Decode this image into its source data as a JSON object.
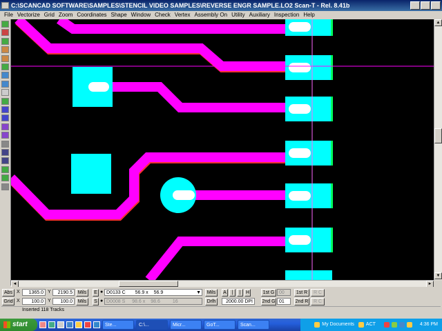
{
  "window": {
    "title": "C:\\SCANCAD SOFTWARE\\SAMPLES\\STENCIL VIDEO SAMPLES\\REVERSE ENGR SAMPLE.LO2  Scan-T - Rel. 8.41b"
  },
  "menu": [
    "File",
    "Vectorize",
    "Grid",
    "Zoom",
    "Coordinates",
    "Shape",
    "Window",
    "Check",
    "Vertex",
    "Assembly On",
    "Utility",
    "Auxiliary",
    "Inspection",
    "Help"
  ],
  "toolbar_icons": [
    "select-tool-icon",
    "zoom-in-icon",
    "zoom-out-icon",
    "pan-icon",
    "track-icon",
    "pad-icon",
    "move-icon",
    "check-icon",
    "print-icon",
    "grid-icon",
    "layer-1-icon",
    "layer-2-icon",
    "layer-3-icon",
    "layer-4-icon",
    "chart-icon",
    "rect-pad-icon",
    "round-pad-icon",
    "node-icon",
    "connect-icon",
    "settings-icon"
  ],
  "colors": {
    "track": "#ff00ff",
    "pad": "#00ffff",
    "canvas": "#000000",
    "highlight": "#ffffff"
  },
  "status": {
    "abs_label": "Abs",
    "abs_x": "1365.0",
    "abs_y": "2190.5",
    "abs_units": "Mils",
    "grid_label": "Grid",
    "grid_x": "100.0",
    "grid_y": "100.0",
    "grid_units": "Mils",
    "e_label": "E",
    "aperture_code": "D0133 C",
    "aperture_x": "56.9 x",
    "aperture_y": "56.9",
    "aperture_units": "Mils",
    "s_label": "S",
    "s_code": "D0008 S",
    "s_x": "98.6 x",
    "s_y": "98.6",
    "s_extra": "16",
    "drill_label": "Drlh",
    "dpi": "2000.00 DPI",
    "btn_a": "A",
    "btn_prev": "|",
    "btn_next": "|",
    "btn_h": "H",
    "first_g": "1st G",
    "first_g_val": "00",
    "first_r": "1st R",
    "rc_1": "R C",
    "second_g": "2nd G",
    "second_g_val": "01",
    "second_r": "2nd R",
    "rc_2": "R C",
    "message": "Inserted 118 Tracks"
  },
  "taskbar": {
    "start": "start",
    "tasks": [
      "Ste...",
      "C:\\...",
      "Micr...",
      "GoT...",
      "Scan..."
    ],
    "my_documents": "My Documents",
    "act": "ACT",
    "clock": "4:36 PM"
  }
}
